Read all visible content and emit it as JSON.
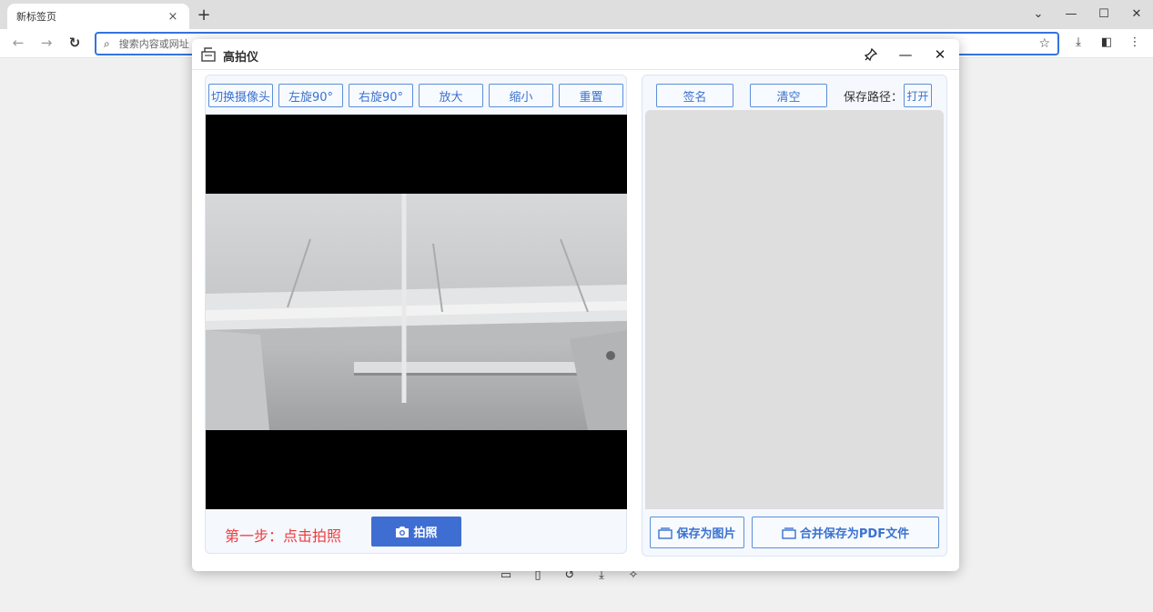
{
  "browser": {
    "tab_title": "新标签页",
    "tab_close": "×",
    "new_tab": "+",
    "address_placeholder": "搜索内容或网址",
    "controls": {
      "tab_search": "⌄",
      "minimize": "—",
      "maximize": "☐",
      "close": "✕"
    }
  },
  "dialog": {
    "title": "高拍仪",
    "left_toolbar": [
      "切换摄像头",
      "左旋90°",
      "右旋90°",
      "放大",
      "缩小",
      "重置"
    ],
    "step_text": "第一步：点击拍照",
    "shoot_label": "拍照",
    "right_toolbar": {
      "sign": "签名",
      "clear": "清空",
      "save_path_label": "保存路径：",
      "open": "打开"
    },
    "save_image": "保存为图片",
    "save_pdf": "合并保存为PDF文件"
  },
  "colors": {
    "accent": "#3f6ed2",
    "step_text": "#ee3b3b",
    "button_border": "#5b8fd9"
  }
}
